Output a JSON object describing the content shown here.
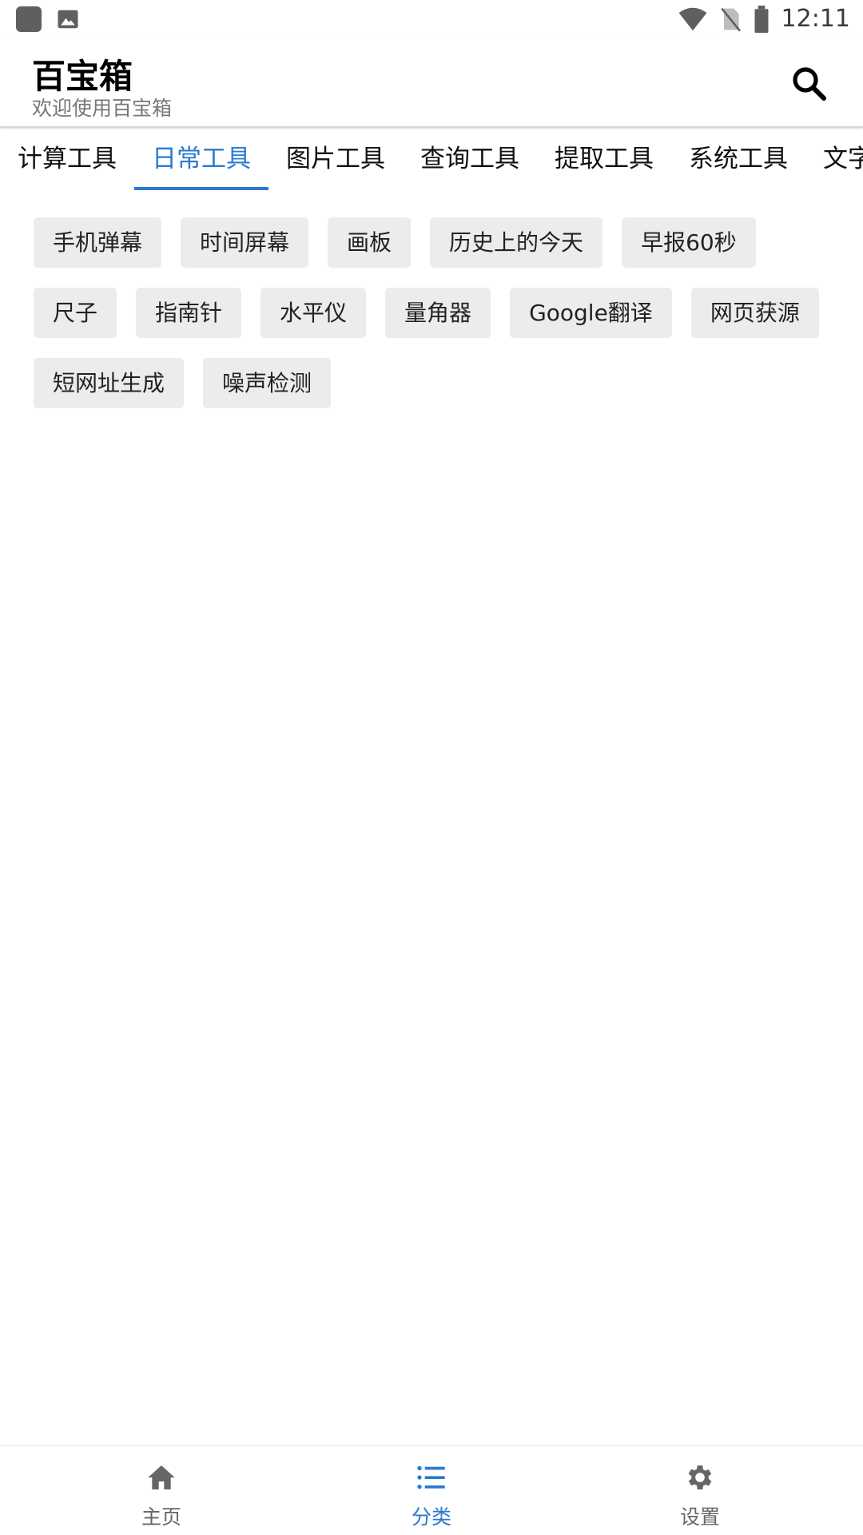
{
  "status_bar": {
    "time": "12:11",
    "icons": [
      "app-icon",
      "image-icon",
      "wifi-icon",
      "no-sim-icon",
      "battery-icon"
    ]
  },
  "header": {
    "title": "百宝箱",
    "subtitle": "欢迎使用百宝箱",
    "search_icon": "search-icon"
  },
  "tabs": [
    {
      "label": "计算工具",
      "active": false
    },
    {
      "label": "日常工具",
      "active": true
    },
    {
      "label": "图片工具",
      "active": false
    },
    {
      "label": "查询工具",
      "active": false
    },
    {
      "label": "提取工具",
      "active": false
    },
    {
      "label": "系统工具",
      "active": false
    },
    {
      "label": "文字",
      "active": false
    }
  ],
  "tools": [
    "手机弹幕",
    "时间屏幕",
    "画板",
    "历史上的今天",
    "早报60秒",
    "尺子",
    "指南针",
    "水平仪",
    "量角器",
    "Google翻译",
    "网页获源",
    "短网址生成",
    "噪声检测"
  ],
  "bottom_nav": [
    {
      "label": "主页",
      "icon": "home-icon",
      "active": false
    },
    {
      "label": "分类",
      "icon": "list-icon",
      "active": true
    },
    {
      "label": "设置",
      "icon": "gear-icon",
      "active": false
    }
  ],
  "colors": {
    "accent": "#2b79d3",
    "chip_bg": "#ececec",
    "icon_gray": "#666666"
  }
}
